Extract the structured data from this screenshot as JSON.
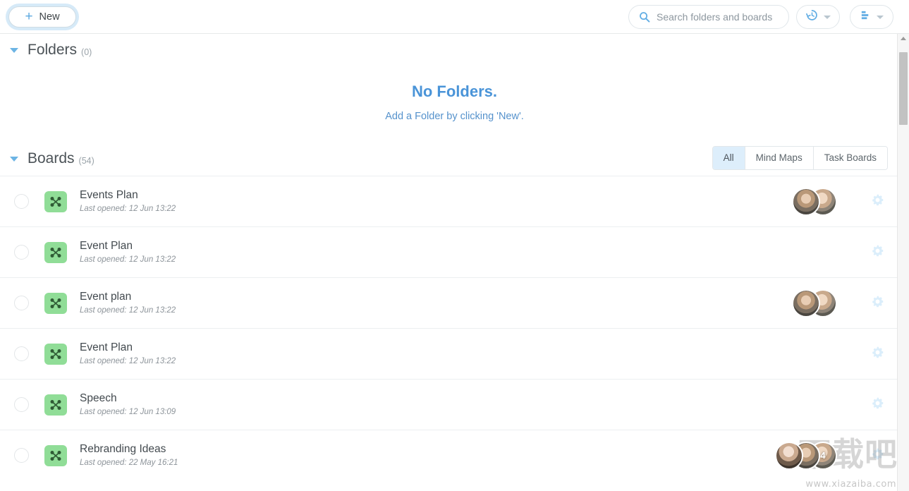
{
  "toolbar": {
    "new_label": "New",
    "plus_icon": "plus-icon",
    "search_placeholder": "Search folders and boards",
    "search_value": "",
    "search_icon": "search-icon",
    "history_icon": "history-clock-icon",
    "sort_icon": "sort-bars-icon",
    "caret_icon": "chevron-down-icon"
  },
  "folders": {
    "title": "Folders",
    "count": "(0)",
    "empty_title": "No Folders.",
    "empty_sub": "Add a Folder by clicking 'New'."
  },
  "boards": {
    "title": "Boards",
    "count": "(54)",
    "filters": [
      {
        "label": "All",
        "active": true
      },
      {
        "label": "Mind Maps",
        "active": false
      },
      {
        "label": "Task Boards",
        "active": false
      }
    ],
    "rows": [
      {
        "title": "Events Plan",
        "subtitle": "Last opened: 12 Jun 13:22",
        "avatars": 2,
        "badge": ""
      },
      {
        "title": "Event Plan",
        "subtitle": "Last opened: 12 Jun 13:22",
        "avatars": 0,
        "badge": ""
      },
      {
        "title": "Event plan",
        "subtitle": "Last opened: 12 Jun 13:22",
        "avatars": 2,
        "badge": ""
      },
      {
        "title": "Event Plan",
        "subtitle": "Last opened: 12 Jun 13:22",
        "avatars": 0,
        "badge": ""
      },
      {
        "title": "Speech",
        "subtitle": "Last opened: 12 Jun 13:09",
        "avatars": 0,
        "badge": ""
      },
      {
        "title": "Rebranding Ideas",
        "subtitle": "Last opened: 22 May 16:21",
        "avatars": 3,
        "badge": "4"
      }
    ]
  },
  "scrollbar": {
    "up_arrow_icon": "triangle-up-icon"
  },
  "watermark": {
    "text_cn": "下载吧",
    "url": "www.xiazaiba.com"
  },
  "colors": {
    "accent_blue": "#4a94d8",
    "board_icon_green": "#90dd97",
    "filter_active_bg": "#ddeefb",
    "gear_blue": "#dbeefb"
  }
}
